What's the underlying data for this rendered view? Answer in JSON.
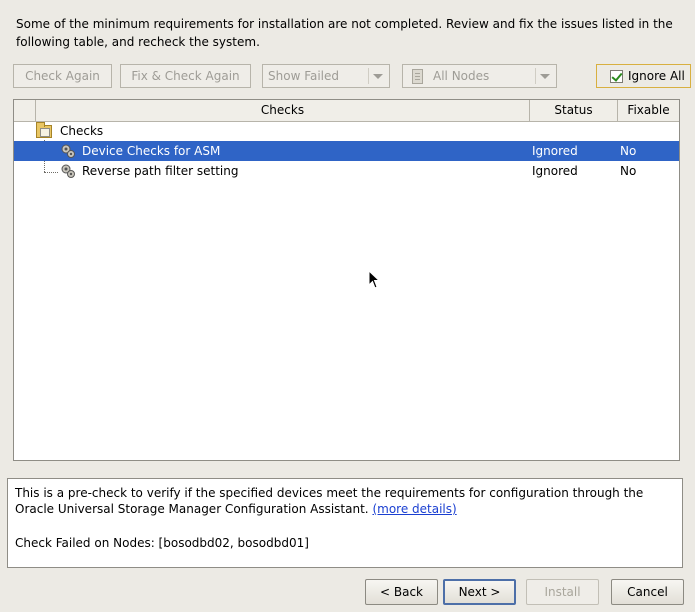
{
  "intro_text": "Some of the minimum requirements for installation are not completed. Review and fix the issues listed in the following table, and recheck the system.",
  "toolbar": {
    "check_again_label": "Check Again",
    "fix_check_again_label": "Fix & Check Again",
    "show_filter_value": "Show Failed",
    "nodes_filter_value": "All Nodes",
    "ignore_all_label": "Ignore All",
    "ignore_all_checked": true
  },
  "table": {
    "columns": [
      "Checks",
      "Status",
      "Fixable"
    ],
    "root_label": "Checks",
    "rows": [
      {
        "check": "Device Checks for ASM",
        "status": "Ignored",
        "fixable": "No",
        "selected": true
      },
      {
        "check": "Reverse path filter setting",
        "status": "Ignored",
        "fixable": "No",
        "selected": false
      }
    ]
  },
  "details": {
    "description": "This is a pre-check to verify if the specified devices meet the requirements for configuration through the Oracle Universal Storage Manager Configuration Assistant.",
    "more_details_link": "(more details)",
    "failed_nodes_text": "Check Failed on Nodes: [bosodbd02, bosodbd01]"
  },
  "footer": {
    "back_label": "< Back",
    "next_label": "Next >",
    "install_label": "Install",
    "cancel_label": "Cancel"
  },
  "colors": {
    "selection": "#2f64c6",
    "link": "#1a3fd1",
    "focus_border": "#d8b040",
    "window_bg": "#eceae4"
  }
}
